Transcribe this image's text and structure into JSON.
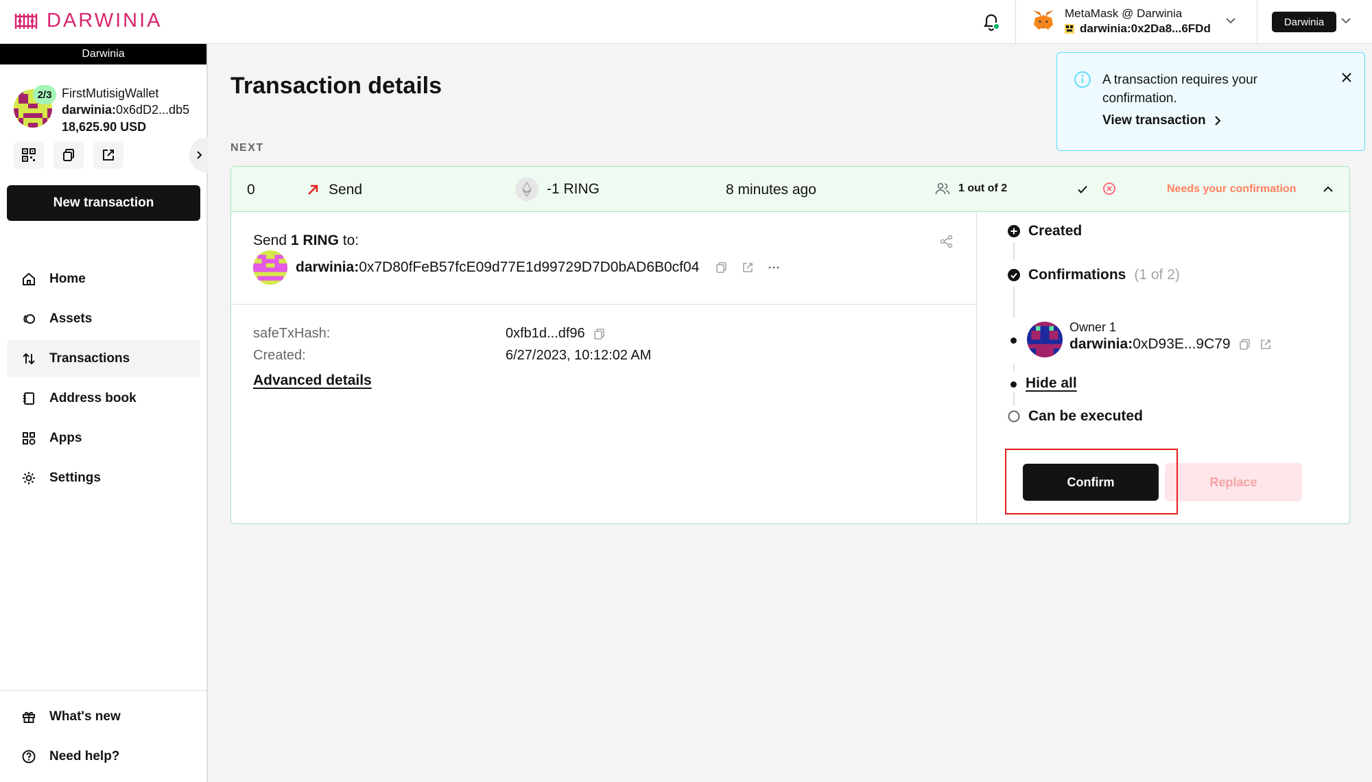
{
  "header": {
    "logo_text": "DARWINIA",
    "wallet": {
      "name": "MetaMask @ Darwinia",
      "address": "darwinia:0x2Da8...6FDd"
    },
    "network": "Darwinia"
  },
  "sidebar": {
    "chain_name": "Darwinia",
    "safe": {
      "threshold": "2/3",
      "name": "FirstMutisigWallet",
      "address_prefix": "darwinia:",
      "address": "0x6dD2...db5",
      "balance": "18,625.90 USD"
    },
    "new_tx_label": "New transaction",
    "nav": [
      {
        "label": "Home",
        "icon": "home-icon"
      },
      {
        "label": "Assets",
        "icon": "assets-icon"
      },
      {
        "label": "Transactions",
        "icon": "transactions-icon",
        "active": true
      },
      {
        "label": "Address book",
        "icon": "address-book-icon"
      },
      {
        "label": "Apps",
        "icon": "apps-icon"
      },
      {
        "label": "Settings",
        "icon": "settings-icon"
      }
    ],
    "footer": [
      {
        "label": "What's new",
        "icon": "gift-icon"
      },
      {
        "label": "Need help?",
        "icon": "help-icon"
      }
    ]
  },
  "main": {
    "title": "Transaction details",
    "section_label": "NEXT",
    "tx": {
      "nonce": "0",
      "type": "Send",
      "amount": "-1 RING",
      "time": "8 minutes ago",
      "confirmations": "1 out of 2",
      "status": "Needs your confirmation",
      "send_prefix": "Send ",
      "send_amount": "1 RING",
      "send_suffix": " to:",
      "recipient_prefix": "darwinia:",
      "recipient": "0x7D80fFeB57fcE09d77E1d99729D7D0bAD6B0cf04",
      "details": {
        "hash_label": "safeTxHash:",
        "hash_value": "0xfb1d...df96",
        "created_label": "Created:",
        "created_value": "6/27/2023, 10:12:02 AM",
        "advanced": "Advanced details"
      },
      "timeline": {
        "created": "Created",
        "confirmations": "Confirmations",
        "confirmations_count": "(1 of 2)",
        "owner_label": "Owner 1",
        "owner_prefix": "darwinia:",
        "owner_addr": "0xD93E...9C79",
        "hide_all": "Hide all",
        "executed": "Can be executed"
      },
      "confirm_label": "Confirm",
      "replace_label": "Replace"
    }
  },
  "toast": {
    "message": "A transaction requires your confirmation.",
    "link": "View transaction"
  },
  "colors": {
    "brand": "#d6246e",
    "status": "#ff8061",
    "success_bg": "#effaf1",
    "toast_bg": "#effaff",
    "highlight": "#e41c1c"
  }
}
